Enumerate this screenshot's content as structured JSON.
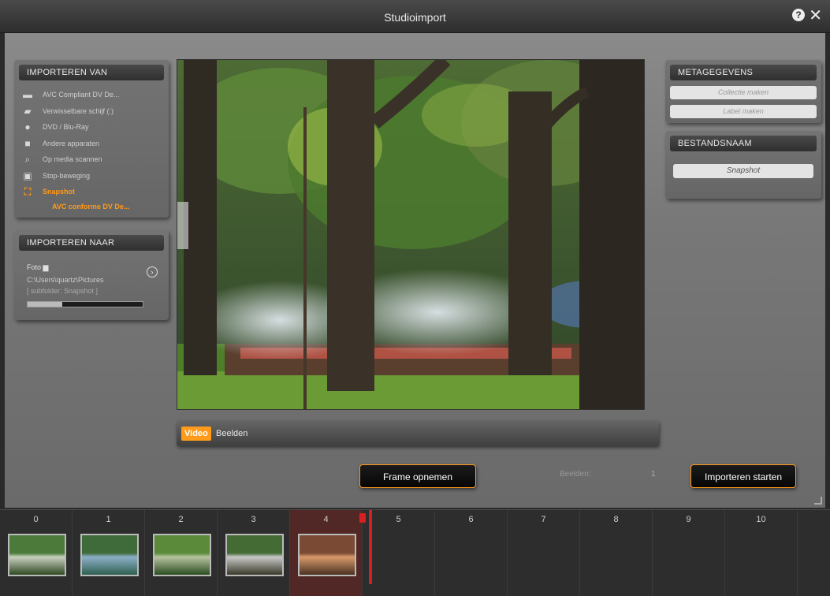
{
  "window": {
    "title": "Studioimport"
  },
  "import_from": {
    "header": "IMPORTEREN VAN",
    "items": [
      {
        "label": "AVC Compliant DV De...",
        "icon": "camcorder-icon",
        "glyph": "▬"
      },
      {
        "label": "Verwisselbare schijf (:)",
        "icon": "removable-drive-icon",
        "glyph": "▰"
      },
      {
        "label": "DVD / Blu-Ray",
        "icon": "disc-icon",
        "glyph": "●"
      },
      {
        "label": "Andere apparaten",
        "icon": "folder-icon",
        "glyph": "■"
      },
      {
        "label": "Op media scannen",
        "icon": "magnifier-icon",
        "glyph": "⌕"
      },
      {
        "label": "Stop-beweging",
        "icon": "stop-motion-icon",
        "glyph": "▣"
      },
      {
        "label": "Snapshot",
        "icon": "snapshot-icon",
        "glyph": "⛶"
      }
    ],
    "active_index": 6,
    "sub_label": "AVC conforme DV De..."
  },
  "import_to": {
    "header": "IMPORTEREN NAAR",
    "label": "Foto",
    "path": "C:\\Users\\quartz\\Pictures",
    "sub": "[ subfolder: Snapshot ]",
    "progress": 0.3
  },
  "metadata": {
    "header": "METAGEGEVENS",
    "collection_placeholder": "Collectie maken",
    "label_placeholder": "Label maken"
  },
  "filename": {
    "header": "BESTANDSNAAM",
    "value": "Snapshot"
  },
  "mode": {
    "video": "Video",
    "images": "Beelden"
  },
  "buttons": {
    "capture": "Frame opnemen",
    "start_import": "Importeren starten"
  },
  "counter": {
    "label": "Beelden:",
    "value": "1"
  },
  "filmstrip": {
    "slots": [
      "0",
      "1",
      "2",
      "3",
      "4",
      "5",
      "6",
      "7",
      "8",
      "9",
      "10"
    ],
    "filled": 5,
    "active_index": 4
  },
  "colors": {
    "accent": "#ff9a1a",
    "marker": "#d42020"
  }
}
